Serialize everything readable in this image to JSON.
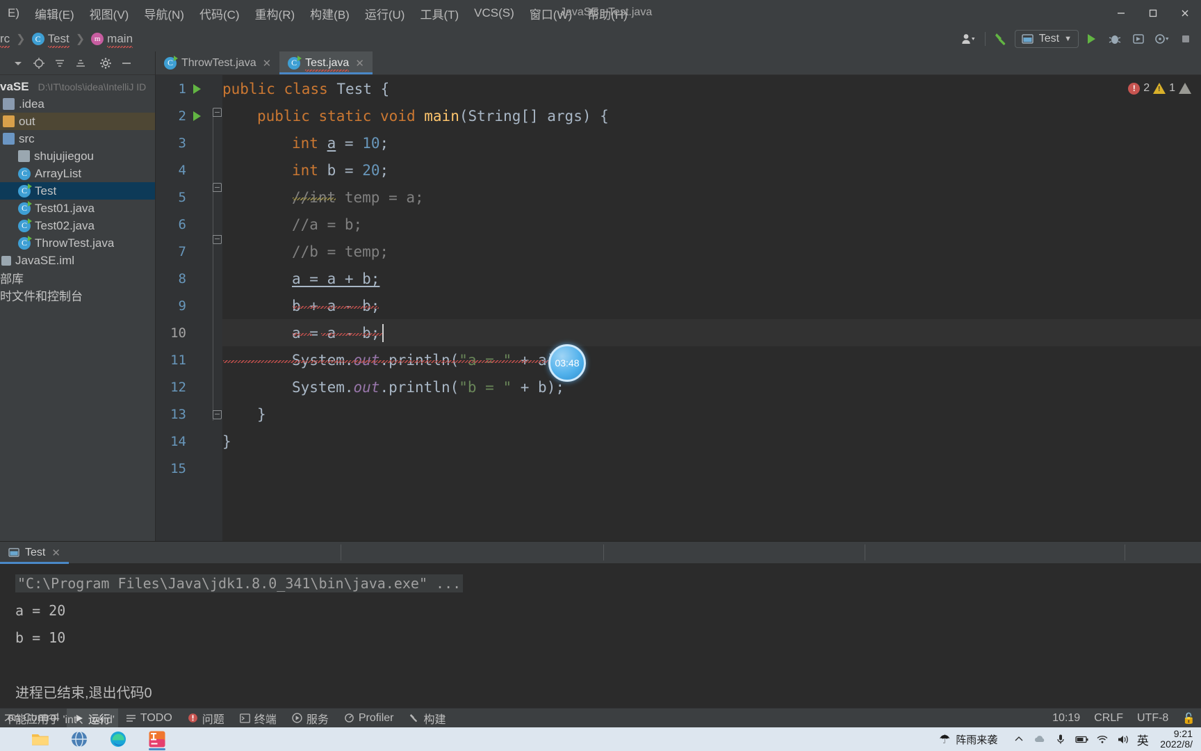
{
  "window": {
    "title": "JavaSE - Test.java",
    "minimize": "─",
    "maximize": "☐",
    "close": "✕"
  },
  "menubar": {
    "items": [
      {
        "label": "E)",
        "name": "menu-file"
      },
      {
        "label": "编辑(E)",
        "name": "menu-edit"
      },
      {
        "label": "视图(V)",
        "name": "menu-view"
      },
      {
        "label": "导航(N)",
        "name": "menu-navigate"
      },
      {
        "label": "代码(C)",
        "name": "menu-code"
      },
      {
        "label": "重构(R)",
        "name": "menu-refactor"
      },
      {
        "label": "构建(B)",
        "name": "menu-build"
      },
      {
        "label": "运行(U)",
        "name": "menu-run"
      },
      {
        "label": "工具(T)",
        "name": "menu-tools"
      },
      {
        "label": "VCS(S)",
        "name": "menu-vcs"
      },
      {
        "label": "窗口(W)",
        "name": "menu-window"
      },
      {
        "label": "帮助(H)",
        "name": "menu-help"
      }
    ]
  },
  "breadcrumb": {
    "root": "rc",
    "class_name": "Test",
    "method_name": "main",
    "separator": "❯"
  },
  "toolbar": {
    "run_config_label": "Test",
    "dropdown_caret": "▼"
  },
  "sidebar": {
    "project_name": "vaSE",
    "project_path": "D:\\IT\\tools\\idea\\IntelliJ ID",
    "items": [
      {
        "label": ".idea",
        "icon": "folder-icon",
        "name": "tree-item-idea",
        "indent": 6,
        "state": "normal"
      },
      {
        "label": "out",
        "icon": "folder-orange-icon",
        "name": "tree-item-out",
        "indent": 6,
        "state": "hl"
      },
      {
        "label": "src",
        "icon": "folder-src-icon",
        "name": "tree-item-src",
        "indent": 6,
        "state": "normal"
      },
      {
        "label": "shujujiegou",
        "icon": "package-icon",
        "name": "tree-item-shujujiegou",
        "indent": 28,
        "state": "normal"
      },
      {
        "label": "ArrayList",
        "icon": "class-icon",
        "name": "tree-item-arraylist",
        "indent": 28,
        "state": "normal"
      },
      {
        "label": "Test",
        "icon": "class-runnable-icon",
        "name": "tree-item-test",
        "indent": 28,
        "state": "selected"
      },
      {
        "label": "Test01.java",
        "icon": "class-runnable-icon",
        "name": "tree-item-test01",
        "indent": 28,
        "state": "normal"
      },
      {
        "label": "Test02.java",
        "icon": "class-runnable-icon",
        "name": "tree-item-test02",
        "indent": 28,
        "state": "normal"
      },
      {
        "label": "ThrowTest.java",
        "icon": "class-runnable-icon",
        "name": "tree-item-throwtest",
        "indent": 28,
        "state": "normal"
      },
      {
        "label": "JavaSE.iml",
        "icon": "module-icon",
        "name": "tree-item-javase-iml",
        "indent": 6,
        "state": "normal"
      },
      {
        "label": "部库",
        "icon": "library-icon",
        "name": "tree-item-external-libraries",
        "indent": 0,
        "state": "normal"
      },
      {
        "label": "时文件和控制台",
        "icon": "scratches-icon",
        "name": "tree-item-scratches-consoles",
        "indent": 0,
        "state": "normal"
      }
    ]
  },
  "editor": {
    "tabs": [
      {
        "label": "ThrowTest.java",
        "active": false,
        "name": "editor-tab-throwtest"
      },
      {
        "label": "Test.java",
        "active": true,
        "name": "editor-tab-test"
      }
    ],
    "close_glyph": "✕",
    "lines": [
      {
        "n": "1",
        "indent": 0
      },
      {
        "n": "2",
        "indent": 0
      },
      {
        "n": "3",
        "indent": 0
      },
      {
        "n": "4",
        "indent": 0
      },
      {
        "n": "5",
        "indent": 0
      },
      {
        "n": "6",
        "indent": 0
      },
      {
        "n": "7",
        "indent": 0
      },
      {
        "n": "8",
        "indent": 0
      },
      {
        "n": "9",
        "indent": 0
      },
      {
        "n": "10",
        "indent": 0
      },
      {
        "n": "11",
        "indent": 0
      },
      {
        "n": "12",
        "indent": 0
      },
      {
        "n": "13",
        "indent": 0
      },
      {
        "n": "14",
        "indent": 0
      },
      {
        "n": "15",
        "indent": 0
      }
    ],
    "code": {
      "l1_public": "public",
      "l1_class": "class",
      "l1_name": "Test",
      "l1_brace": "{",
      "l2_public": "public",
      "l2_static": "static",
      "l2_void": "void",
      "l2_main": "main",
      "l2_args": "(String[] args) {",
      "l3": "int a = 10;",
      "l3_kw": "int",
      "l3_var": "a",
      "l3_eq": " = ",
      "l3_num": "10",
      "l3_semi": ";",
      "l4_kw": "int",
      "l4_var": "b",
      "l4_num": "20",
      "l5": "//int temp = a;",
      "l6": "//a = b;",
      "l7": "//b = temp;",
      "l8": "a = a + b;",
      "l9": "b + a - b;",
      "l10": "a = a - b;",
      "l11_sys": "System.",
      "l11_out": "out",
      "l11_pr": ".println(",
      "l11_str": "\"a = \"",
      "l11_plus": " + ",
      "l11_var": "a",
      "l11_end": ");",
      "l12_str": "\"b = \"",
      "l12_var": "b",
      "l13": "}",
      "l14": "}"
    },
    "inspections": {
      "error_count": "2",
      "warning_count": "1",
      "exclaim": "!"
    },
    "timer_label": "03:48"
  },
  "run_window": {
    "tab_label": "Test",
    "close_glyph": "✕",
    "console": {
      "command": "\"C:\\Program Files\\Java\\jdk1.8.0_341\\bin\\java.exe\" ...",
      "out_a": "a = 20",
      "out_b": "b = 10",
      "exit": "进程已结束,退出代码0"
    }
  },
  "toolstrip": {
    "items": [
      {
        "label": "on Control",
        "icon": "version-control-icon",
        "active": false,
        "name": "tool-tab-version-control"
      },
      {
        "label": "运行",
        "icon": "run-icon",
        "active": true,
        "name": "tool-tab-run"
      },
      {
        "label": "TODO",
        "icon": "todo-icon",
        "active": false,
        "name": "tool-tab-todo"
      },
      {
        "label": "问题",
        "icon": "problems-icon",
        "active": false,
        "name": "tool-tab-problems"
      },
      {
        "label": "终端",
        "icon": "terminal-icon",
        "active": false,
        "name": "tool-tab-terminal"
      },
      {
        "label": "服务",
        "icon": "services-icon",
        "active": false,
        "name": "tool-tab-services"
      },
      {
        "label": "Profiler",
        "icon": "profiler-icon",
        "active": false,
        "name": "tool-tab-profiler"
      },
      {
        "label": "构建",
        "icon": "build-icon",
        "active": false,
        "name": "tool-tab-build"
      }
    ]
  },
  "statusbar": {
    "message": "不能应用于 'int'、'void'",
    "caret_position": "10:19",
    "line_separator": "CRLF",
    "encoding": "UTF-8"
  },
  "taskbar": {
    "apps": [
      {
        "name": "taskbar-file-explorer",
        "icon": "folder-icon",
        "running": false
      },
      {
        "name": "taskbar-browser",
        "icon": "browser-icon",
        "running": false
      },
      {
        "name": "taskbar-edge",
        "icon": "edge-icon",
        "running": false
      },
      {
        "name": "taskbar-intellij",
        "icon": "intellij-icon",
        "running": true
      }
    ],
    "weather": "阵雨来袭",
    "ime": "英",
    "time": "9:21",
    "date": "2022/8/"
  },
  "colors": {
    "accent": "#4a88c7",
    "error": "#c75450",
    "warning": "#d9b02a",
    "run_green": "#62b543",
    "keyword": "#cc7832",
    "string": "#6a8759",
    "number": "#6897bb",
    "comment": "#808080",
    "method": "#ffc66d",
    "field": "#9876aa",
    "editor_bg": "#2b2b2b",
    "panel_bg": "#3c3f41"
  }
}
